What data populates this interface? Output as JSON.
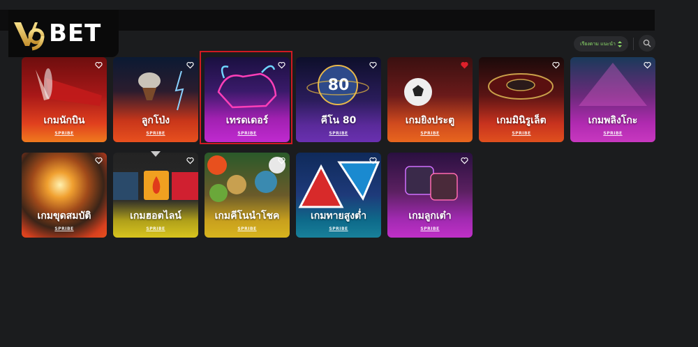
{
  "brand": {
    "logo_text": "BET",
    "logo_mark": "V9"
  },
  "toolbar": {
    "sort_label": "เรียงตาม แนะนำ",
    "sort_icon": "sort-arrows-icon",
    "search_icon": "search-icon"
  },
  "colors": {
    "accent": "#8fe06b",
    "selected_border": "#d11a22",
    "background": "#1b1c1e"
  },
  "games": [
    {
      "title": "เกมนักบิน",
      "provider": "SPRIBE",
      "favorite": false
    },
    {
      "title": "ลูกโป่ง",
      "provider": "SPRIBE",
      "favorite": false
    },
    {
      "title": "เทรดเดอร์",
      "provider": "SPRIBE",
      "favorite": false,
      "selected": true
    },
    {
      "title": "คีโน 80",
      "provider": "SPRIBE",
      "favorite": false,
      "ball_number": "80"
    },
    {
      "title": "เกมยิงประตู",
      "provider": "SPRIBE",
      "favorite": true
    },
    {
      "title": "เกมมินิรูเล็ต",
      "provider": "SPRIBE",
      "favorite": false
    },
    {
      "title": "เกมพลิงโกะ",
      "provider": "SPRIBE",
      "favorite": false
    },
    {
      "title": "เกมขุดสมบัติ",
      "provider": "SPRIBE",
      "favorite": false
    },
    {
      "title": "เกมฮอตไลน์",
      "provider": "SPRIBE",
      "favorite": false
    },
    {
      "title": "เกมคีโนนำโชค",
      "provider": "SPRIBE",
      "favorite": false
    },
    {
      "title": "เกมทายสูงต่ำ",
      "provider": "SPRIBE",
      "favorite": false
    },
    {
      "title": "เกมลูกเต๋า",
      "provider": "SPRIBE",
      "favorite": false
    }
  ]
}
